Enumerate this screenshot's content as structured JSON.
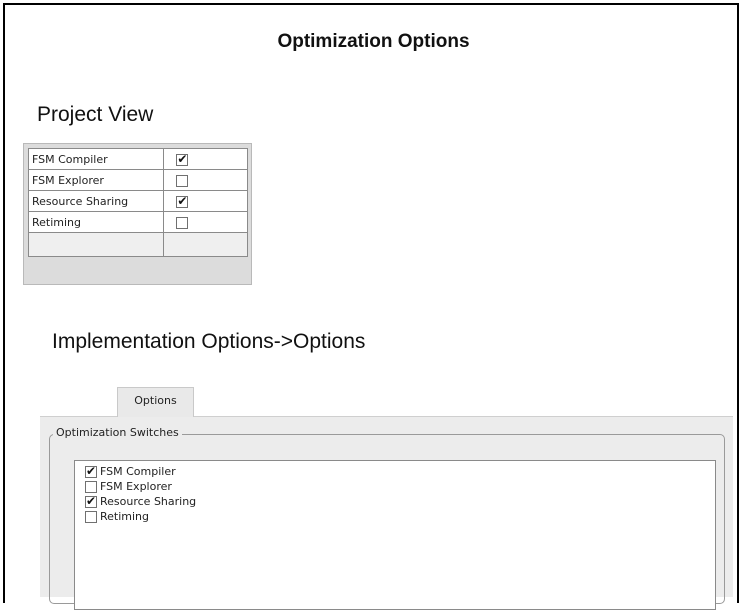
{
  "title": "Optimization Options",
  "project_view": {
    "label": "Project View",
    "rows": [
      {
        "name": "FSM Compiler",
        "checked": true
      },
      {
        "name": "FSM Explorer",
        "checked": false
      },
      {
        "name": "Resource Sharing",
        "checked": true
      },
      {
        "name": "Retiming",
        "checked": false
      }
    ]
  },
  "implementation": {
    "label": "Implementation Options->Options",
    "tab_label": "Options",
    "group_label": "Optimization Switches",
    "items": [
      {
        "name": "FSM Compiler",
        "checked": true
      },
      {
        "name": "FSM Explorer",
        "checked": false
      },
      {
        "name": "Resource Sharing",
        "checked": true
      },
      {
        "name": "Retiming",
        "checked": false
      }
    ]
  }
}
